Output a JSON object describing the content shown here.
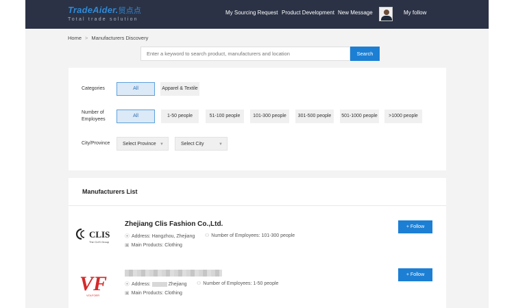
{
  "header": {
    "logo_text": "TradeAider.",
    "logo_cn": "贸点点",
    "logo_tagline": "Total trade solution",
    "nav": [
      "My Sourcing Request",
      "Product Development",
      "New Message"
    ],
    "my_follow": "My follow"
  },
  "breadcrumb": {
    "home": "Home",
    "separator": ">",
    "current": "Manufacturers Discovery"
  },
  "search": {
    "placeholder": "Enter a keyword to search product, manufacturers and location",
    "button": "Search"
  },
  "filters": {
    "categories": {
      "label": "Categories",
      "options": [
        "All",
        "Apparel & Textile"
      ],
      "selected": "All"
    },
    "employees": {
      "label_line1": "Number of",
      "label_line2": "Employees",
      "options": [
        "All",
        "1-50 people",
        "51-100 people",
        "101-300 people",
        "301-500 people",
        "501-1000 people",
        ">1000 people"
      ],
      "selected": "All"
    },
    "location": {
      "label": "City/Province",
      "province": "Select Province",
      "city": "Select City"
    }
  },
  "list": {
    "title": "Manufacturers List",
    "companies": [
      {
        "name": "Zhejiang Clis Fashion Co.,Ltd.",
        "logo_text": "CLIS",
        "logo_sub": "The CLIS Group",
        "address_label": "Address:",
        "address": "Hangzhou, Zhejiang",
        "employees_label": "Number of Employees:",
        "employees": "101-300 people",
        "products_label": "Main Products:",
        "products": "Clothing",
        "follow": "+ Follow"
      },
      {
        "name": "",
        "logo_text": "VF",
        "logo_sub": "VOLFOER",
        "address_label": "Address:",
        "address": "Zhejiang",
        "employees_label": "Number of Employees:",
        "employees": "1-50 people",
        "products_label": "Main Products:",
        "products": "Clothing",
        "follow": "+ Follow"
      }
    ]
  },
  "colors": {
    "header_bg": "#2b3245",
    "accent": "#1c7fd4",
    "page_bg": "#f3f3f3"
  }
}
